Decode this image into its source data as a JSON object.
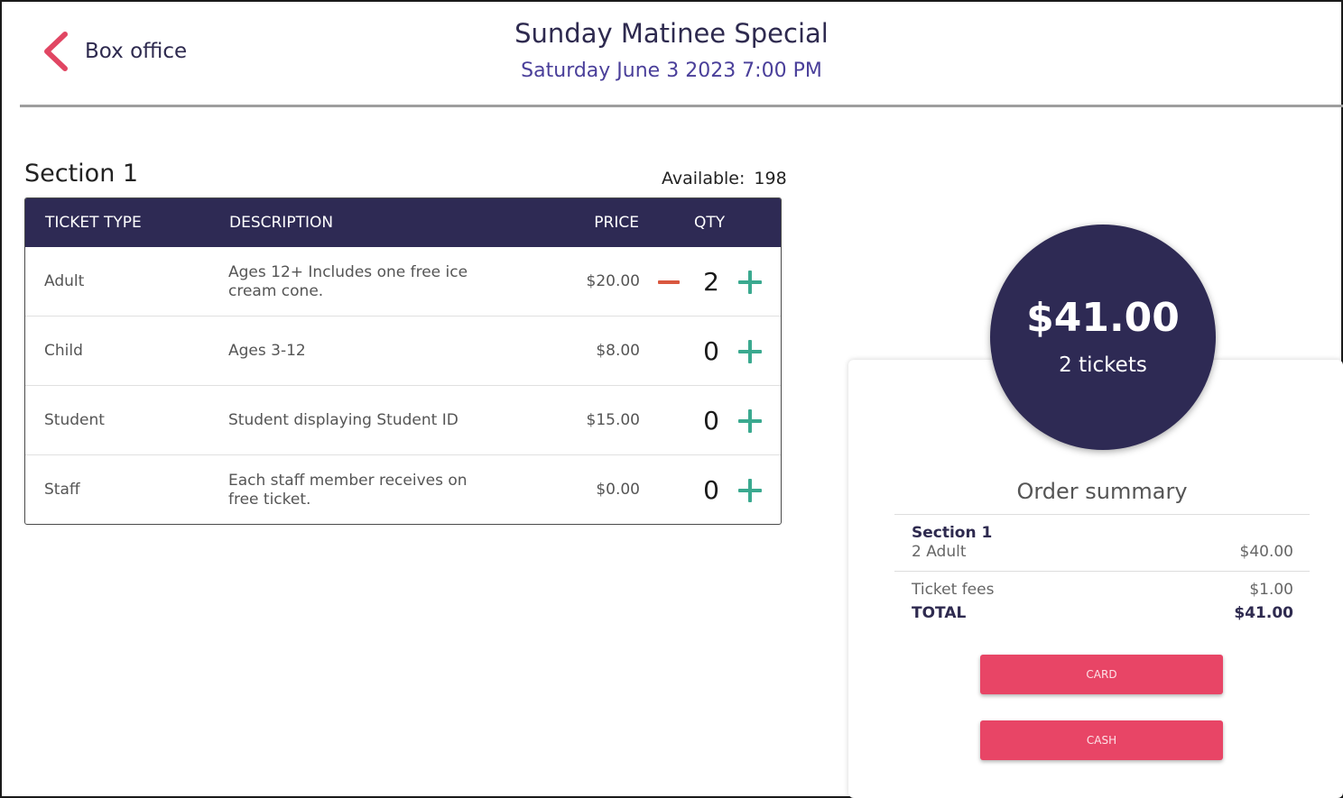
{
  "header": {
    "back_label": "Box office",
    "title": "Sunday Matinee Special",
    "subtitle": "Saturday June 3 2023 7:00 PM"
  },
  "section": {
    "title": "Section 1",
    "available_label": "Available:",
    "available_value": "198",
    "columns": {
      "type": "TICKET TYPE",
      "description": "DESCRIPTION",
      "price": "PRICE",
      "qty": "QTY"
    },
    "rows": [
      {
        "type": "Adult",
        "description": "Ages 12+ Includes one free ice cream cone.",
        "price": "$20.00",
        "qty": "2"
      },
      {
        "type": "Child",
        "description": "Ages 3-12",
        "price": "$8.00",
        "qty": "0"
      },
      {
        "type": "Student",
        "description": "Student displaying Student ID",
        "price": "$15.00",
        "qty": "0"
      },
      {
        "type": "Staff",
        "description": "Each staff member receives on free ticket.",
        "price": "$0.00",
        "qty": "0"
      }
    ]
  },
  "total_badge": {
    "amount": "$41.00",
    "tickets": "2 tickets"
  },
  "summary": {
    "title": "Order summary",
    "section_name": "Section 1",
    "line_label": "2 Adult",
    "line_amount": "$40.00",
    "fees_label": "Ticket fees",
    "fees_amount": "$1.00",
    "total_label": "TOTAL",
    "total_amount": "$41.00"
  },
  "buttons": {
    "card": "CARD",
    "cash": "CASH"
  },
  "colors": {
    "navy": "#2e2a54",
    "accent_red": "#e84566",
    "plus_green": "#3aa98f",
    "minus_orange": "#d9573f"
  }
}
